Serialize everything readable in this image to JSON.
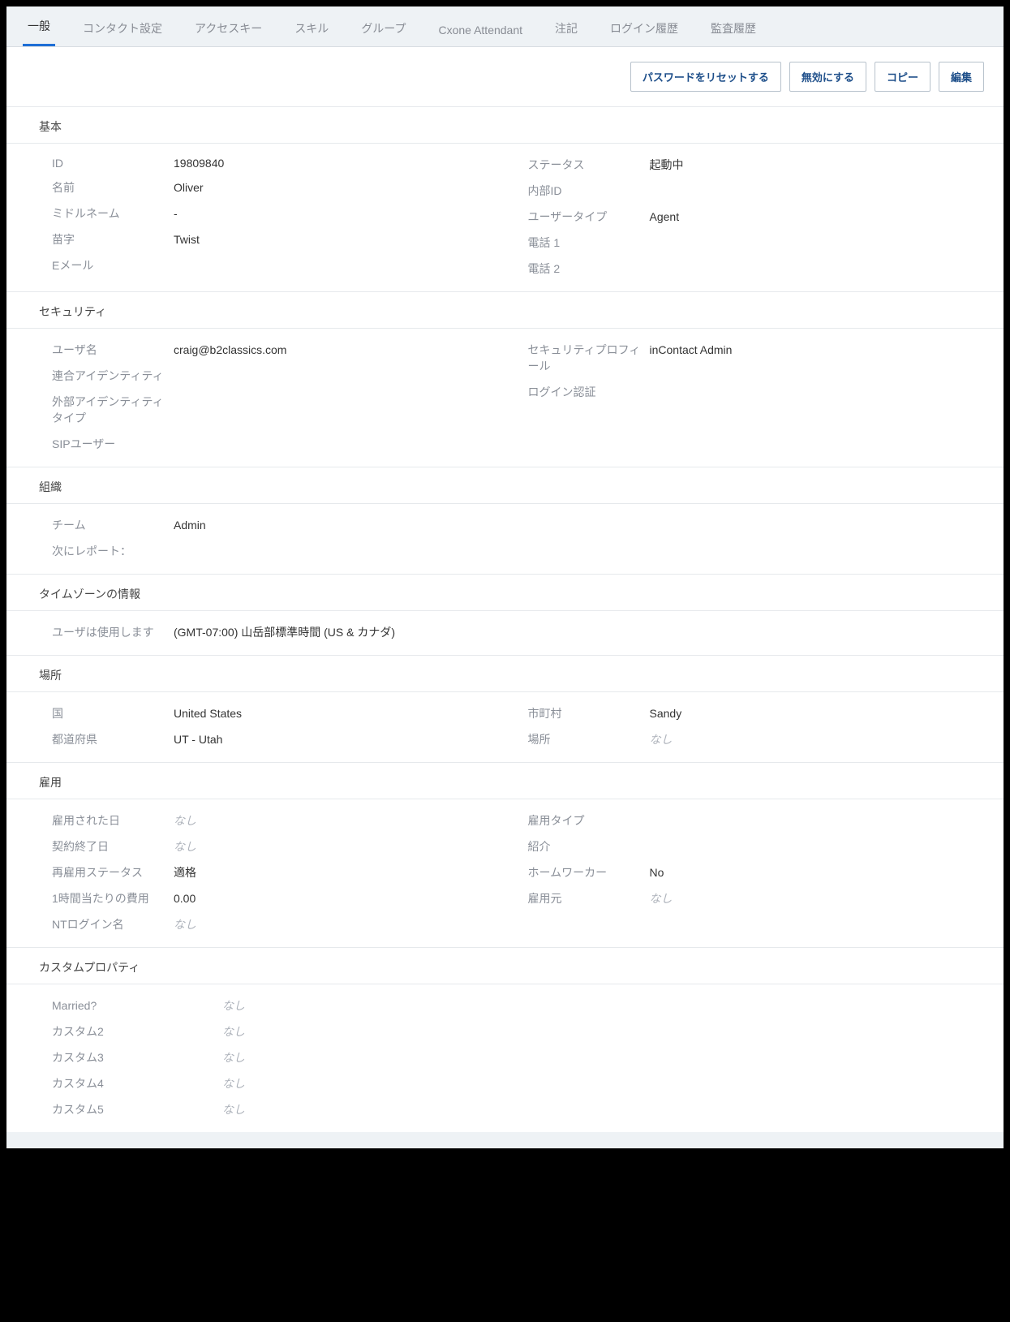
{
  "tabs": {
    "general": "一般",
    "contact_settings": "コンタクト設定",
    "access_key": "アクセスキー",
    "skill": "スキル",
    "group": "グループ",
    "attendant": "Cxone Attendant",
    "notes": "注記",
    "login_history": "ログイン履歴",
    "audit_history": "監査履歴"
  },
  "actions": {
    "reset_password": "パスワードをリセットする",
    "disable": "無効にする",
    "copy": "コピー",
    "edit": "編集"
  },
  "sections": {
    "basic": {
      "title": "基本",
      "id_label": "ID",
      "id_value": "19809840",
      "name_label": "名前",
      "name_value": "Oliver",
      "middle_label": "ミドルネーム",
      "middle_value": "-",
      "lastname_label": "苗字",
      "lastname_value": "Twist",
      "email_label": "Eメール",
      "email_value": "",
      "status_label": "ステータス",
      "status_value": "起動中",
      "internal_id_label": "内部ID",
      "internal_id_value": "",
      "user_type_label": "ユーザータイプ",
      "user_type_value": "Agent",
      "phone1_label": "電話 1",
      "phone1_value": "",
      "phone2_label": "電話 2",
      "phone2_value": ""
    },
    "security": {
      "title": "セキュリティ",
      "username_label": "ユーザ名",
      "username_value": "craig@b2classics.com",
      "federated_label": "連合アイデンティティ",
      "federated_value": "",
      "external_id_type_label": "外部アイデンティティタイプ",
      "external_id_type_value": "",
      "sip_user_label": "SIPユーザー",
      "sip_user_value": "",
      "security_profile_label": "セキュリティプロフィール",
      "security_profile_value": "inContact Admin",
      "login_auth_label": "ログイン認証",
      "login_auth_value": ""
    },
    "org": {
      "title": "組織",
      "team_label": "チーム",
      "team_value": "Admin",
      "reports_to_label": "次にレポート：",
      "reports_to_value": ""
    },
    "timezone": {
      "title": "タイムゾーンの情報",
      "user_uses_label": "ユーザは使用します",
      "user_uses_value": "(GMT-07:00) 山岳部標準時間 (US & カナダ)"
    },
    "location": {
      "title": "場所",
      "country_label": "国",
      "country_value": "United States",
      "state_label": "都道府県",
      "state_value": "UT - Utah",
      "city_label": "市町村",
      "city_value": "Sandy",
      "location_label": "場所",
      "location_value": "なし"
    },
    "employment": {
      "title": "雇用",
      "hire_date_label": "雇用された日",
      "hire_date_value": "なし",
      "term_date_label": "契約終了日",
      "term_date_value": "なし",
      "rehire_status_label": "再雇用ステータス",
      "rehire_status_value": "適格",
      "hourly_cost_label": "1時間当たりの費用",
      "hourly_cost_value": "0.00",
      "nt_login_label": "NTログイン名",
      "nt_login_value": "なし",
      "emp_type_label": "雇用タイプ",
      "emp_type_value": "",
      "referral_label": "紹介",
      "referral_value": "",
      "home_worker_label": "ホームワーカー",
      "home_worker_value": "No",
      "employer_label": "雇用元",
      "employer_value": "なし"
    },
    "custom": {
      "title": "カスタムプロパティ",
      "c1_label": "Married?",
      "c1_value": "なし",
      "c2_label": "カスタム2",
      "c2_value": "なし",
      "c3_label": "カスタム3",
      "c3_value": "なし",
      "c4_label": "カスタム4",
      "c4_value": "なし",
      "c5_label": "カスタム5",
      "c5_value": "なし"
    }
  }
}
